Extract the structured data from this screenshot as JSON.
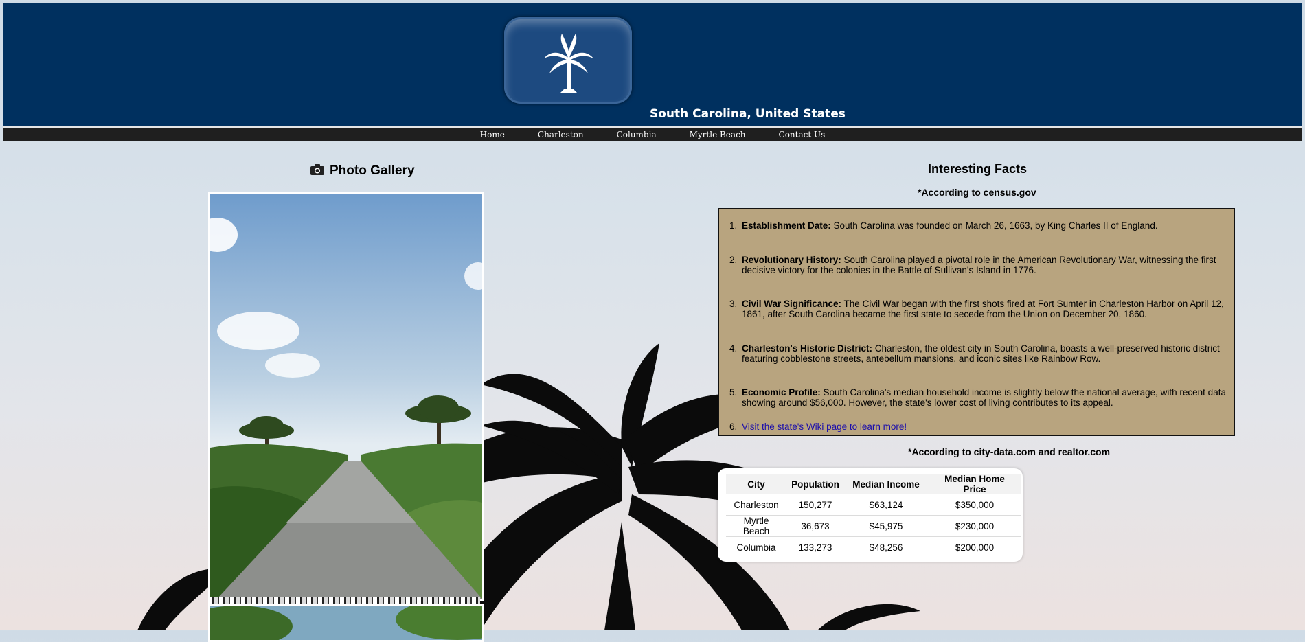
{
  "header": {
    "site_title": "South Carolina, United States",
    "logo_icon": "palmetto-flag-icon",
    "background_color": "#00305f"
  },
  "nav": {
    "items": [
      {
        "label": "Home"
      },
      {
        "label": "Charleston"
      },
      {
        "label": "Columbia"
      },
      {
        "label": "Myrtle Beach"
      },
      {
        "label": "Contact Us"
      }
    ]
  },
  "gallery": {
    "title": "Photo Gallery",
    "icon": "camera-icon"
  },
  "facts": {
    "title": "Interesting Facts",
    "source": "*According to census.gov",
    "items": [
      {
        "number": "1.",
        "heading": "Establishment Date:",
        "text": " South Carolina was founded on March 26, 1663, by King Charles II of England."
      },
      {
        "number": "2.",
        "heading": "Revolutionary History:",
        "text": " South Carolina played a pivotal role in the American Revolutionary War, witnessing the first decisive victory for the colonies in the Battle of Sullivan's Island in 1776."
      },
      {
        "number": "3.",
        "heading": "Civil War Significance:",
        "text": " The Civil War began with the first shots fired at Fort Sumter in Charleston Harbor on April 12, 1861, after South Carolina became the first state to secede from the Union on December 20, 1860."
      },
      {
        "number": "4.",
        "heading": "Charleston's Historic District:",
        "text": " Charleston, the oldest city in South Carolina, boasts a well-preserved historic district featuring cobblestone streets, antebellum mansions, and iconic sites like Rainbow Row."
      },
      {
        "number": "5.",
        "heading": "Economic Profile:",
        "text": " South Carolina's median household income is slightly below the national average, with recent data showing around $56,000. However, the state's lower cost of living contributes to its appeal."
      }
    ],
    "wiki_number": "6.",
    "wiki_link": "Visit the state's Wiki page to learn more!",
    "box_color": "#b8a47f"
  },
  "city_table": {
    "source": "*According to city-data.com and realtor.com",
    "headers": [
      "City",
      "Population",
      "Median Income",
      "Median Home Price"
    ],
    "rows": [
      [
        "Charleston",
        "150,277",
        "$63,124",
        "$350,000"
      ],
      [
        "Myrtle Beach",
        "36,673",
        "$45,975",
        "$230,000"
      ],
      [
        "Columbia",
        "133,273",
        "$48,256",
        "$200,000"
      ]
    ]
  }
}
